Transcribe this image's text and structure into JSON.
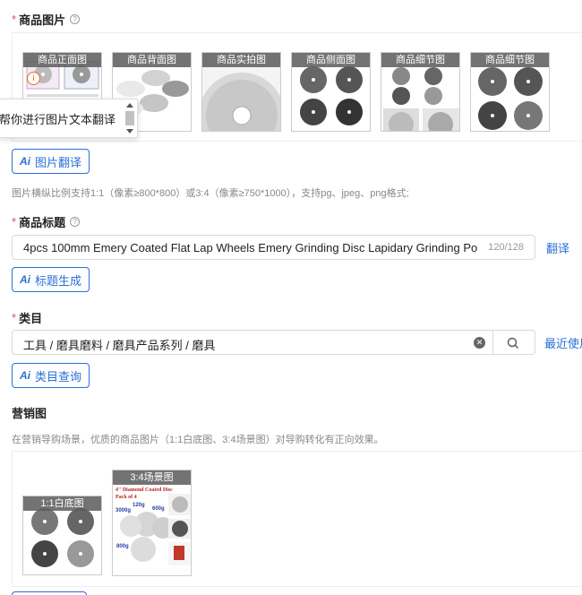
{
  "product_images": {
    "label": "商品图片",
    "help": "?",
    "thumbs": [
      {
        "caption": "商品正面图"
      },
      {
        "caption": "商品背面图"
      },
      {
        "caption": "商品实拍图"
      },
      {
        "caption": "商品侧面图"
      },
      {
        "caption": "商品细节图"
      },
      {
        "caption": "商品细节图"
      }
    ],
    "info_badge": "i",
    "tooltip": "帮你进行图片文本翻译",
    "translate_button": "图片翻译",
    "hint": "图片横纵比例支持1:1（像素≥800*800）或3:4（像素≥750*1000），支持pg、jpeg、png格式;"
  },
  "title": {
    "label": "商品标题",
    "help": "?",
    "value": "4pcs 100mm Emery Coated Flat Lap Wheels Emery Grinding Disc Lapidary Grinding Polishin",
    "counter": "120/128",
    "translate_link": "翻译",
    "generate_button": "标题生成"
  },
  "category": {
    "label": "类目",
    "value": "工具 / 磨具磨料 / 磨具产品系列 / 磨具",
    "recent_link": "最近使用",
    "query_button": "类目查询"
  },
  "marketing": {
    "label": "营销图",
    "hint": "在营销导购场景，优质的商品图片（1:1白底图、3:4场景图）对导购转化有正向效果。",
    "thumbs": [
      {
        "caption": "1:1白底图"
      },
      {
        "caption": "3:4场景图"
      }
    ],
    "scene_texts": [
      "4\" Diamond Coated Disc",
      "Pack of 4",
      "120g",
      "600g",
      "3000g",
      "800g"
    ]
  },
  "ai_badge": "Ai",
  "colors": {
    "accent": "#2a6fd6",
    "required": "#e5484d",
    "border": "#d9d9d9"
  }
}
